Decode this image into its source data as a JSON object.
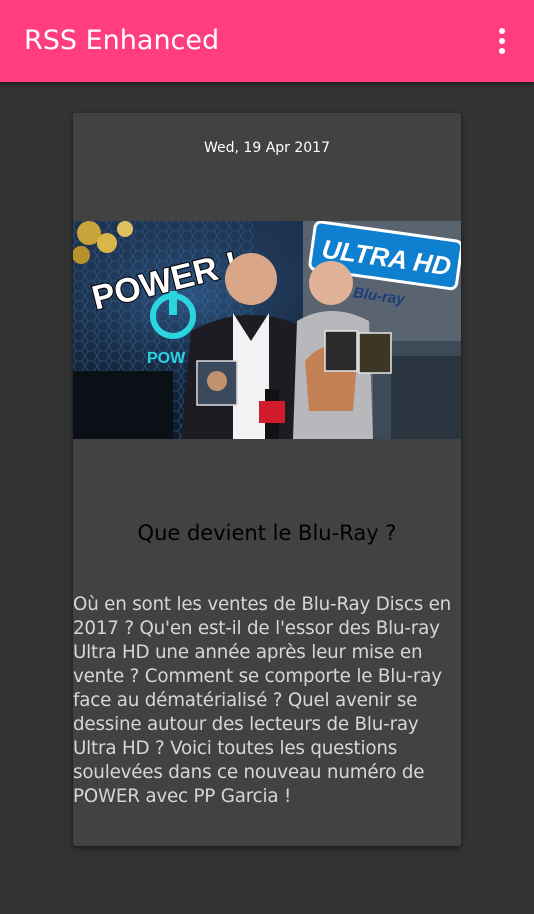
{
  "appbar": {
    "title": "RSS Enhanced",
    "menu_icon": "overflow-menu-icon",
    "background_color": "#ff3d7f"
  },
  "feed": {
    "items": [
      {
        "date": "Wed, 19 Apr 2017",
        "image": {
          "texts": {
            "power": "POWER !",
            "ultra": "ULTRA HD",
            "bluray": "Blu-ray",
            "logo": "POW"
          }
        },
        "title": "Que devient le Blu-Ray ?",
        "description": "Où en sont les ventes de Blu-Ray Discs en 2017 ? Qu'en est-il de l'essor des Blu-ray Ultra HD une année après leur mise en vente ? Comment se comporte le Blu-ray face au dématérialisé ? Quel avenir se dessine autour des lecteurs de Blu-ray Ultra HD ? Voici toutes les questions soulevées dans ce nouveau numéro de POWER avec PP Garcia !"
      }
    ]
  },
  "colors": {
    "background": "#333333",
    "card": "#424242",
    "description_text": "#d6d6d6"
  }
}
